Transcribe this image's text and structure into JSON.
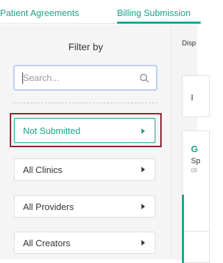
{
  "tabs": [
    {
      "label": "Patient Agreements"
    },
    {
      "label": "Billing Submission"
    }
  ],
  "filter": {
    "title": "Filter by",
    "search_placeholder": "Search...",
    "buttons": [
      {
        "label": "Not Submitted",
        "active": true
      },
      {
        "label": "All Clinics",
        "active": false
      },
      {
        "label": "All Providers",
        "active": false
      },
      {
        "label": "All Creators",
        "active": false
      }
    ]
  },
  "right_panel": {
    "display_label": "Disp",
    "card_a_letter": "I",
    "card_b_title": "G",
    "card_b_subtitle": "Sp",
    "card_b_small": "09"
  },
  "colors": {
    "accent": "#1aa38a",
    "highlight": "#8a1f2d",
    "panel_bg": "#f5f5f5"
  }
}
